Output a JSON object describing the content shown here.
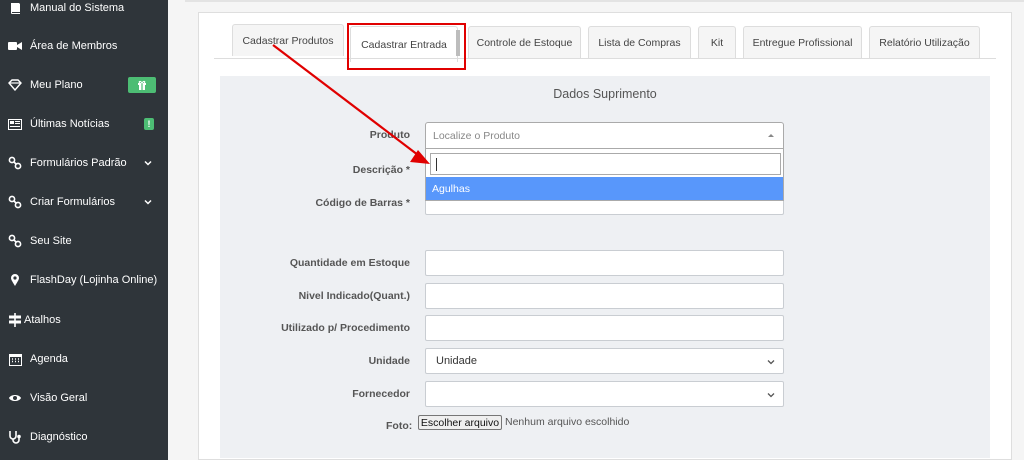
{
  "sidebar": {
    "items": [
      {
        "label": "Manual do Sistema",
        "icon": "book-icon"
      },
      {
        "label": "Área de Membros",
        "icon": "video-camera-icon"
      },
      {
        "label": "Meu Plano",
        "icon": "diamond-icon",
        "badge_icon": "gift-icon"
      },
      {
        "label": "Últimas Notícias",
        "icon": "newspaper-icon",
        "badge_text": "!"
      },
      {
        "label": "Formulários Padrão",
        "icon": "link-icon"
      },
      {
        "label": "Criar Formulários",
        "icon": "link-icon"
      },
      {
        "label": "Seu Site",
        "icon": "link-icon"
      },
      {
        "label": "FlashDay (Lojinha Online)",
        "icon": "map-marker-icon"
      },
      {
        "label": "Atalhos",
        "icon": "signpost-icon"
      },
      {
        "label": "Agenda",
        "icon": "calendar-icon"
      },
      {
        "label": "Visão Geral",
        "icon": "eye-icon"
      },
      {
        "label": "Diagnóstico",
        "icon": "stethoscope-icon"
      }
    ]
  },
  "tabs": [
    {
      "label": "Cadastrar Produtos"
    },
    {
      "label": "Cadastrar Entrada"
    },
    {
      "label": "Controle de Estoque"
    },
    {
      "label": "Lista de Compras"
    },
    {
      "label": "Kit"
    },
    {
      "label": "Entregue Profissional"
    },
    {
      "label": "Relatório Utilização"
    }
  ],
  "form": {
    "title": "Dados Suprimento",
    "produto_label": "Produto",
    "produto_placeholder": "Localize o Produto",
    "dropdown_option": "Agulhas",
    "descricao_label": "Descrição *",
    "codigo_label": "Código de Barras *",
    "quantidade_label": "Quantidade em Estoque",
    "nivel_label": "Nivel Indicado(Quant.)",
    "utilizado_label": "Utilizado p/ Procedimento",
    "unidade_label": "Unidade",
    "unidade_value": "Unidade",
    "fornecedor_label": "Fornecedor",
    "fornecedor_value": "",
    "foto_label": "Foto:",
    "file_button": "Escolher arquivo",
    "file_status": "Nenhum arquivo escolhido"
  },
  "colors": {
    "sidebar_bg": "#2f353a",
    "accent_green": "#4dbd74",
    "highlight_option": "#5897fb",
    "annotation_red": "#e00000"
  }
}
